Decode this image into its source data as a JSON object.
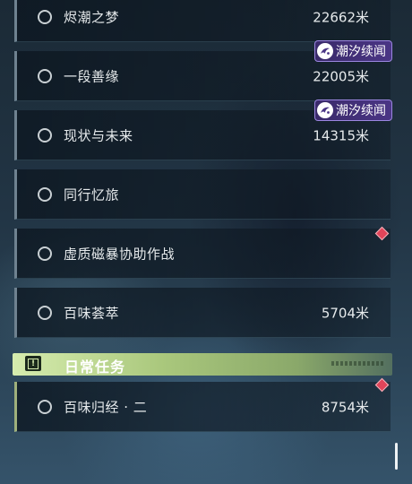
{
  "quests": [
    {
      "name": "烬潮之梦",
      "distance": "22662米"
    },
    {
      "name": "一段善缘",
      "distance": "22005米",
      "badge": "潮汐续闻"
    },
    {
      "name": "现状与未来",
      "distance": "14315米",
      "badge": "潮汐续闻"
    },
    {
      "name": "同行忆旅",
      "distance": ""
    },
    {
      "name": "虚质磁暴协助作战",
      "distance": ""
    },
    {
      "name": "百味荟萃",
      "distance": "5704米"
    }
  ],
  "daily_section": {
    "title": "日常任务",
    "quests": [
      {
        "name": "百味归经 · 二",
        "distance": "8754米"
      }
    ]
  },
  "colors": {
    "badge_purple": "#4a3585",
    "daily_green": "#a9c77c",
    "marker_red": "#e0455a"
  },
  "icons": {
    "quest_status": "hollow-circle-icon",
    "badge": "tidal-swirl-icon",
    "tracking": "red-diamond-icon",
    "daily": "exclamation-box-icon"
  }
}
